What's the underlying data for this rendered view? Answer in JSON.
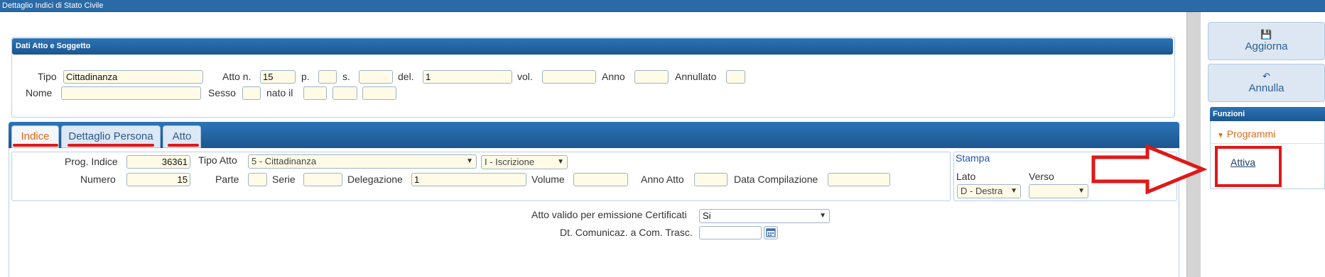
{
  "window": {
    "title": "Dettaglio Indici di Stato Civile"
  },
  "section_atto": {
    "title": "Dati Atto e Soggetto",
    "labels": {
      "tipo": "Tipo",
      "atto_n": "Atto n.",
      "p": "p.",
      "s": "s.",
      "del": "del.",
      "vol": "vol.",
      "anno": "Anno",
      "annullato": "Annullato",
      "nome": "Nome",
      "sesso": "Sesso",
      "nato_il": "nato il"
    },
    "values": {
      "tipo": "Cittadinanza",
      "atto_n": "15",
      "p": "",
      "s": "",
      "del": "1",
      "vol": "",
      "anno": "",
      "annullato": "",
      "nome": "",
      "sesso": ""
    }
  },
  "tabs": [
    {
      "label": "Indice",
      "active": true
    },
    {
      "label": "Dettaglio Persona",
      "active": false
    },
    {
      "label": "Atto",
      "active": false
    }
  ],
  "indice": {
    "labels": {
      "prog_indice": "Prog. Indice",
      "tipo_atto": "Tipo Atto",
      "numero": "Numero",
      "parte": "Parte",
      "serie": "Serie",
      "delegazione": "Delegazione",
      "volume": "Volume",
      "anno_atto": "Anno Atto",
      "data_compilazione": "Data Compilazione"
    },
    "values": {
      "prog_indice": "36361",
      "tipo_atto": "5 - Cittadinanza",
      "tipo_registro": "I - Iscrizione",
      "numero": "15",
      "parte": "",
      "serie": "",
      "delegazione": "1",
      "volume": ""
    }
  },
  "stampa": {
    "title": "Stampa",
    "lato_label": "Lato",
    "verso_label": "Verso",
    "lato_value": "D - Destra",
    "verso_value": ""
  },
  "certificati": {
    "valido_label": "Atto valido per emissione Certificati",
    "valido_value": "Si",
    "comunicaz_label": "Dt. Comunicaz. a Com. Trasc.",
    "comunicaz_value": ""
  },
  "side": {
    "aggiorna": "Aggiorna",
    "annulla": "Annulla",
    "funzioni": "Funzioni",
    "programmi": "Programmi",
    "attiva": "Attiva"
  },
  "colors": {
    "header_blue": "#1f5f9c",
    "field_bg": "#fffbe6",
    "active_tab": "#e06a1a",
    "annotation_red": "#e01818"
  }
}
